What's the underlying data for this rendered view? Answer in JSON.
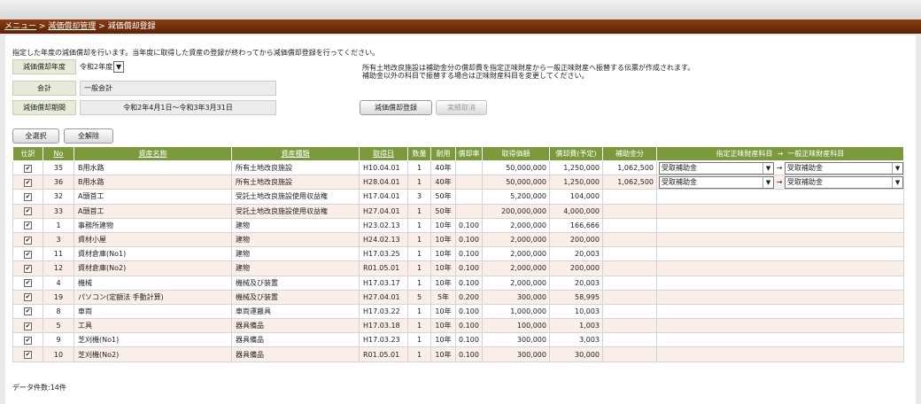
{
  "breadcrumb": {
    "menu": "メニュー",
    "sep": " > ",
    "parent": "減価償却管理",
    "current": "減価償却登録"
  },
  "instruction": "指定した年度の減価償却を行います。当年度に取得した資産の登録が終わってから減価償却登録を行ってください。",
  "form": {
    "year_label": "減価償却年度",
    "year_value": "令和2年度",
    "year_arrow": "▼",
    "account_label": "会計",
    "account_value": "一般会計",
    "period_label": "減価償却期間",
    "period_value": "令和2年4月1日～令和3年3月31日"
  },
  "note_lines": [
    "所有土地改良施設は補助金分の償却費を指定正味財産から一般正味財産へ振替する伝票が作成されます。",
    "補助金以外の科目で振替する場合は正味財産科目を変更してください。"
  ],
  "buttons": {
    "register": "減価償却登録",
    "cancel": "実績取消",
    "select_all": "全選択",
    "deselect_all": "全解除"
  },
  "table": {
    "headers": [
      "仕訳",
      "No",
      "資産名称",
      "資産種類",
      "取得日",
      "数量",
      "耐用",
      "償却率",
      "取得価額",
      "償却費(予定)",
      "補助金分",
      "指定正味財産科目",
      "→",
      "一般正味財産科目"
    ],
    "rows": [
      {
        "no": "35",
        "name": "B用水路",
        "type": "所有土地改良施設",
        "date": "H10.04.01",
        "qty": "1",
        "life": "40年",
        "rate": "",
        "cost": "50,000,000",
        "dep": "1,250,000",
        "sub": "1,062,500",
        "from": "受取補助金",
        "to": "受取補助金"
      },
      {
        "no": "36",
        "name": "B用水路",
        "type": "所有土地改良施設",
        "date": "H28.04.01",
        "qty": "1",
        "life": "40年",
        "rate": "",
        "cost": "50,000,000",
        "dep": "1,250,000",
        "sub": "1,062,500",
        "from": "受取補助金",
        "to": "受取補助金"
      },
      {
        "no": "32",
        "name": "A頭首工",
        "type": "受託土地改良施設使用収益権",
        "date": "H17.04.01",
        "qty": "3",
        "life": "50年",
        "rate": "",
        "cost": "5,200,000",
        "dep": "104,000",
        "sub": "",
        "from": "",
        "to": ""
      },
      {
        "no": "33",
        "name": "A頭首工",
        "type": "受託土地改良施設使用収益権",
        "date": "H27.04.01",
        "qty": "1",
        "life": "50年",
        "rate": "",
        "cost": "200,000,000",
        "dep": "4,000,000",
        "sub": "",
        "from": "",
        "to": ""
      },
      {
        "no": "1",
        "name": "事務所建物",
        "type": "建物",
        "date": "H23.02.13",
        "qty": "1",
        "life": "10年",
        "rate": "0.100",
        "cost": "2,000,000",
        "dep": "166,666",
        "sub": "",
        "from": "",
        "to": ""
      },
      {
        "no": "3",
        "name": "資材小屋",
        "type": "建物",
        "date": "H24.02.13",
        "qty": "1",
        "life": "10年",
        "rate": "0.100",
        "cost": "2,000,000",
        "dep": "200,000",
        "sub": "",
        "from": "",
        "to": ""
      },
      {
        "no": "11",
        "name": "資材倉庫(No1)",
        "type": "建物",
        "date": "H17.03.25",
        "qty": "1",
        "life": "10年",
        "rate": "0.100",
        "cost": "2,000,000",
        "dep": "20,003",
        "sub": "",
        "from": "",
        "to": ""
      },
      {
        "no": "12",
        "name": "資材倉庫(No2)",
        "type": "建物",
        "date": "R01.05.01",
        "qty": "1",
        "life": "10年",
        "rate": "0.100",
        "cost": "2,000,000",
        "dep": "200,000",
        "sub": "",
        "from": "",
        "to": ""
      },
      {
        "no": "4",
        "name": "機械",
        "type": "機械及び装置",
        "date": "H17.03.17",
        "qty": "1",
        "life": "10年",
        "rate": "0.100",
        "cost": "2,000,000",
        "dep": "20,003",
        "sub": "",
        "from": "",
        "to": ""
      },
      {
        "no": "19",
        "name": "パソコン(定額法 手動計算)",
        "type": "機械及び装置",
        "date": "H27.04.01",
        "qty": "5",
        "life": "5年",
        "rate": "0.200",
        "cost": "300,000",
        "dep": "58,995",
        "sub": "",
        "from": "",
        "to": ""
      },
      {
        "no": "8",
        "name": "車両",
        "type": "車両運搬具",
        "date": "H17.03.22",
        "qty": "1",
        "life": "10年",
        "rate": "0.100",
        "cost": "1,000,000",
        "dep": "10,003",
        "sub": "",
        "from": "",
        "to": ""
      },
      {
        "no": "5",
        "name": "工具",
        "type": "器具備品",
        "date": "H17.03.18",
        "qty": "1",
        "life": "10年",
        "rate": "0.100",
        "cost": "100,000",
        "dep": "1,003",
        "sub": "",
        "from": "",
        "to": ""
      },
      {
        "no": "9",
        "name": "芝刈機(No1)",
        "type": "器具備品",
        "date": "H17.03.23",
        "qty": "1",
        "life": "10年",
        "rate": "0.100",
        "cost": "300,000",
        "dep": "3,003",
        "sub": "",
        "from": "",
        "to": ""
      },
      {
        "no": "10",
        "name": "芝刈機(No2)",
        "type": "器具備品",
        "date": "R01.05.01",
        "qty": "1",
        "life": "10年",
        "rate": "0.100",
        "cost": "300,000",
        "dep": "30,000",
        "sub": "",
        "from": "",
        "to": ""
      }
    ]
  },
  "check_glyph": "✔",
  "dropdown_arrow": "▼",
  "data_count": "データ件数:14件"
}
